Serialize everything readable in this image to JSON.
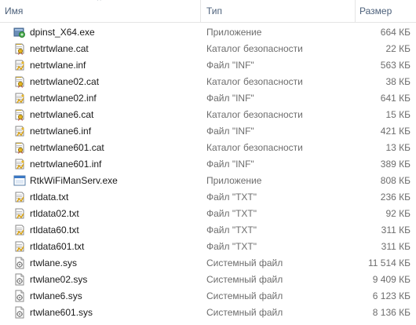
{
  "columns": {
    "name": "Имя",
    "type": "Тип",
    "size": "Размер",
    "sort_indicator": "^"
  },
  "files": [
    {
      "name": "dpinst_X64.exe",
      "type": "Приложение",
      "size": "664 КБ",
      "icon": "installer-exe-icon"
    },
    {
      "name": "netrtwlane.cat",
      "type": "Каталог безопасности",
      "size": "22 КБ",
      "icon": "security-catalog-icon"
    },
    {
      "name": "netrtwlane.inf",
      "type": "Файл \"INF\"",
      "size": "563 КБ",
      "icon": "inf-file-icon"
    },
    {
      "name": "netrtwlane02.cat",
      "type": "Каталог безопасности",
      "size": "38 КБ",
      "icon": "security-catalog-icon"
    },
    {
      "name": "netrtwlane02.inf",
      "type": "Файл \"INF\"",
      "size": "641 КБ",
      "icon": "inf-file-icon"
    },
    {
      "name": "netrtwlane6.cat",
      "type": "Каталог безопасности",
      "size": "15 КБ",
      "icon": "security-catalog-icon"
    },
    {
      "name": "netrtwlane6.inf",
      "type": "Файл \"INF\"",
      "size": "421 КБ",
      "icon": "inf-file-icon"
    },
    {
      "name": "netrtwlane601.cat",
      "type": "Каталог безопасности",
      "size": "13 КБ",
      "icon": "security-catalog-icon"
    },
    {
      "name": "netrtwlane601.inf",
      "type": "Файл \"INF\"",
      "size": "389 КБ",
      "icon": "inf-file-icon"
    },
    {
      "name": "RtkWiFiManServ.exe",
      "type": "Приложение",
      "size": "808 КБ",
      "icon": "application-exe-icon"
    },
    {
      "name": "rtldata.txt",
      "type": "Файл \"TXT\"",
      "size": "236 КБ",
      "icon": "txt-file-icon"
    },
    {
      "name": "rtldata02.txt",
      "type": "Файл \"TXT\"",
      "size": "92 КБ",
      "icon": "txt-file-icon"
    },
    {
      "name": "rtldata60.txt",
      "type": "Файл \"TXT\"",
      "size": "311 КБ",
      "icon": "txt-file-icon"
    },
    {
      "name": "rtldata601.txt",
      "type": "Файл \"TXT\"",
      "size": "311 КБ",
      "icon": "txt-file-icon"
    },
    {
      "name": "rtwlane.sys",
      "type": "Системный файл",
      "size": "11 514 КБ",
      "icon": "system-file-icon"
    },
    {
      "name": "rtwlane02.sys",
      "type": "Системный файл",
      "size": "9 409 КБ",
      "icon": "system-file-icon"
    },
    {
      "name": "rtwlane6.sys",
      "type": "Системный файл",
      "size": "6 123 КБ",
      "icon": "system-file-icon"
    },
    {
      "name": "rtwlane601.sys",
      "type": "Системный файл",
      "size": "8 136 КБ",
      "icon": "system-file-icon"
    }
  ]
}
